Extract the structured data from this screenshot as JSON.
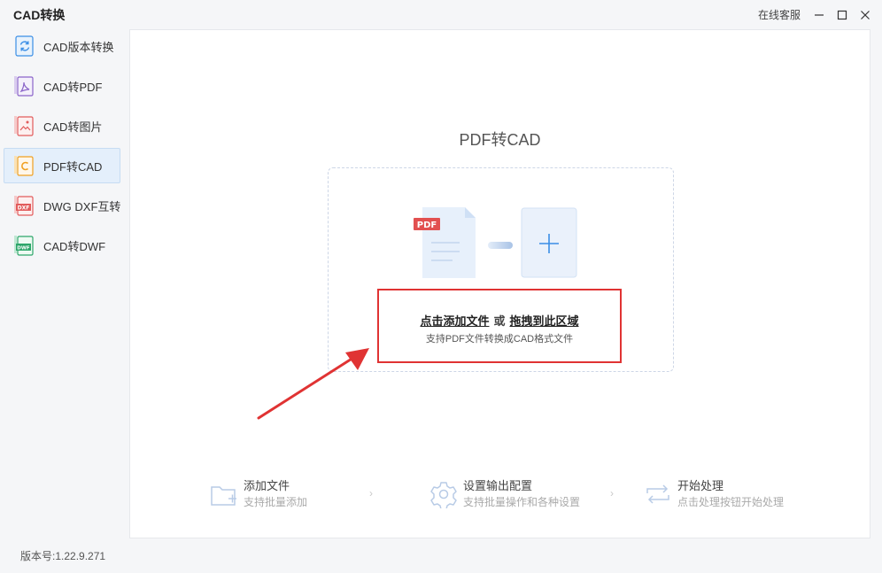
{
  "app": {
    "title": "CAD转换"
  },
  "window": {
    "service_label": "在线客服"
  },
  "sidebar": {
    "items": [
      {
        "label": "CAD版本转换",
        "icon": "refresh-file-icon",
        "color": "#3a8ee6"
      },
      {
        "label": "CAD转PDF",
        "icon": "pdf-file-icon",
        "color": "#8a63c9"
      },
      {
        "label": "CAD转图片",
        "icon": "image-file-icon",
        "color": "#e25b5b"
      },
      {
        "label": "PDF转CAD",
        "icon": "cad-file-icon",
        "color": "#f0a020",
        "active": true
      },
      {
        "label": "DWG DXF互转",
        "icon": "dxf-file-icon",
        "color": "#e25b5b"
      },
      {
        "label": "CAD转DWF",
        "icon": "dwf-file-icon",
        "color": "#2da66a"
      }
    ]
  },
  "main": {
    "heading": "PDF转CAD",
    "dropzone": {
      "badge": "PDF",
      "click_text": "点击添加文件",
      "or_text": "或",
      "drag_text": "拖拽到此区域",
      "sub_text": "支持PDF文件转换成CAD格式文件",
      "highlight_color": "#e03333"
    },
    "steps": [
      {
        "title": "添加文件",
        "sub": "支持批量添加",
        "icon": "folder-add-icon"
      },
      {
        "title": "设置输出配置",
        "sub": "支持批量操作和各种设置",
        "icon": "gear-icon"
      },
      {
        "title": "开始处理",
        "sub": "点击处理按钮开始处理",
        "icon": "repeat-icon"
      }
    ],
    "step_separator": "›"
  },
  "footer": {
    "version": "版本号:1.22.9.271"
  },
  "colors": {
    "accent": "#3a8ee6",
    "active_bg": "#e4effb",
    "arrow": "#e03333"
  }
}
